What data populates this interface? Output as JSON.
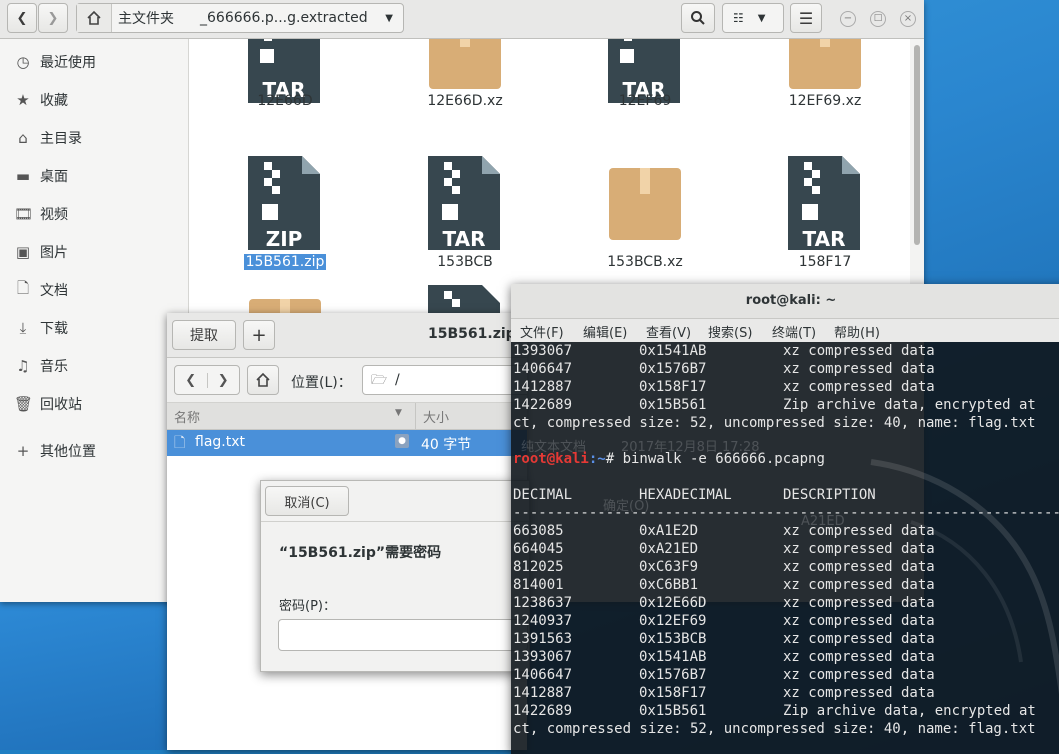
{
  "file_manager": {
    "breadcrumb_home": "主文件夹",
    "breadcrumb_folder": "_666666.p...g.extracted",
    "sidebar": [
      {
        "label": "最近使用",
        "icon": "clock-icon"
      },
      {
        "label": "收藏",
        "icon": "star-icon"
      },
      {
        "label": "主目录",
        "icon": "home-icon"
      },
      {
        "label": "桌面",
        "icon": "desktop-icon"
      },
      {
        "label": "视频",
        "icon": "film-icon"
      },
      {
        "label": "图片",
        "icon": "picture-icon"
      },
      {
        "label": "文档",
        "icon": "document-icon"
      },
      {
        "label": "下载",
        "icon": "download-icon"
      },
      {
        "label": "音乐",
        "icon": "music-icon"
      },
      {
        "label": "回收站",
        "icon": "trash-icon"
      },
      {
        "label": "其他位置",
        "icon": "plus-icon"
      }
    ],
    "files": [
      {
        "name": "12E66D",
        "type": "TAR"
      },
      {
        "name": "12E66D.xz",
        "type": "BOX"
      },
      {
        "name": "12EF69",
        "type": "TAR"
      },
      {
        "name": "12EF69.xz",
        "type": "BOX"
      },
      {
        "name": "15B561.zip",
        "type": "ZIP"
      },
      {
        "name": "153BCB",
        "type": "TAR"
      },
      {
        "name": "153BCB.xz",
        "type": "BOX"
      },
      {
        "name": "158F17",
        "type": "TAR"
      }
    ]
  },
  "archive_manager": {
    "title": "15B561.zip",
    "extract_label": "提取",
    "add_label": "+",
    "location_label": "位置(L)：",
    "location_value": "/",
    "col_name": "名称",
    "col_size": "大小",
    "file_name": "flag.txt",
    "file_size": "40 字节"
  },
  "password_dialog": {
    "cancel_label": "取消(C)",
    "message": "“15B561.zip”需要密码",
    "password_label": "密码(P)：",
    "password_value": ""
  },
  "terminal": {
    "title": "root@kali: ~",
    "menu": [
      "文件(F)",
      "编辑(E)",
      "查看(V)",
      "搜索(S)",
      "终端(T)",
      "帮助(H)"
    ],
    "prompt_user": "root@kali",
    "prompt_path": ":~",
    "prompt_symbol": "# ",
    "command": "binwalk -e 666666.pcapng",
    "header": [
      "DECIMAL",
      "HEXADECIMAL",
      "DESCRIPTION"
    ],
    "separator": "--------------------------------------------------------------------------------",
    "pre_rows": [
      [
        "1393067",
        "0x1541AB",
        "xz compressed data"
      ],
      [
        "1406647",
        "0x1576B7",
        "xz compressed data"
      ],
      [
        "1412887",
        "0x158F17",
        "xz compressed data"
      ],
      [
        "1422689",
        "0x15B561",
        "Zip archive data, encrypted at"
      ]
    ],
    "pre_wrap": "ct, compressed size: 52, uncompressed size: 40, name: flag.txt",
    "rows": [
      [
        "663085",
        "0xA1E2D",
        "xz compressed data"
      ],
      [
        "664045",
        "0xA21ED",
        "xz compressed data"
      ],
      [
        "812025",
        "0xC63F9",
        "xz compressed data"
      ],
      [
        "814001",
        "0xC6BB1",
        "xz compressed data"
      ],
      [
        "1238637",
        "0x12E66D",
        "xz compressed data"
      ],
      [
        "1240937",
        "0x12EF69",
        "xz compressed data"
      ],
      [
        "1391563",
        "0x153BCB",
        "xz compressed data"
      ],
      [
        "1393067",
        "0x1541AB",
        "xz compressed data"
      ],
      [
        "1406647",
        "0x1576B7",
        "xz compressed data"
      ],
      [
        "1412887",
        "0x158F17",
        "xz compressed data"
      ],
      [
        "1422689",
        "0x15B561",
        "Zip archive data, encrypted at"
      ]
    ],
    "post_wrap": "ct, compressed size: 52, uncompressed size: 40, name: flag.txt",
    "ghost": {
      "doc_label": "纯文本文档",
      "date_text": "2017年12月8日 17:28",
      "ok_label": "确定(O)",
      "file_name": "A21ED"
    }
  },
  "colors": {
    "selection": "#4a90d9",
    "prompt_red": "#e53935",
    "prompt_blue": "#5a8fe6",
    "tar_icon": "#37474f",
    "box_icon": "#d8ad76"
  }
}
